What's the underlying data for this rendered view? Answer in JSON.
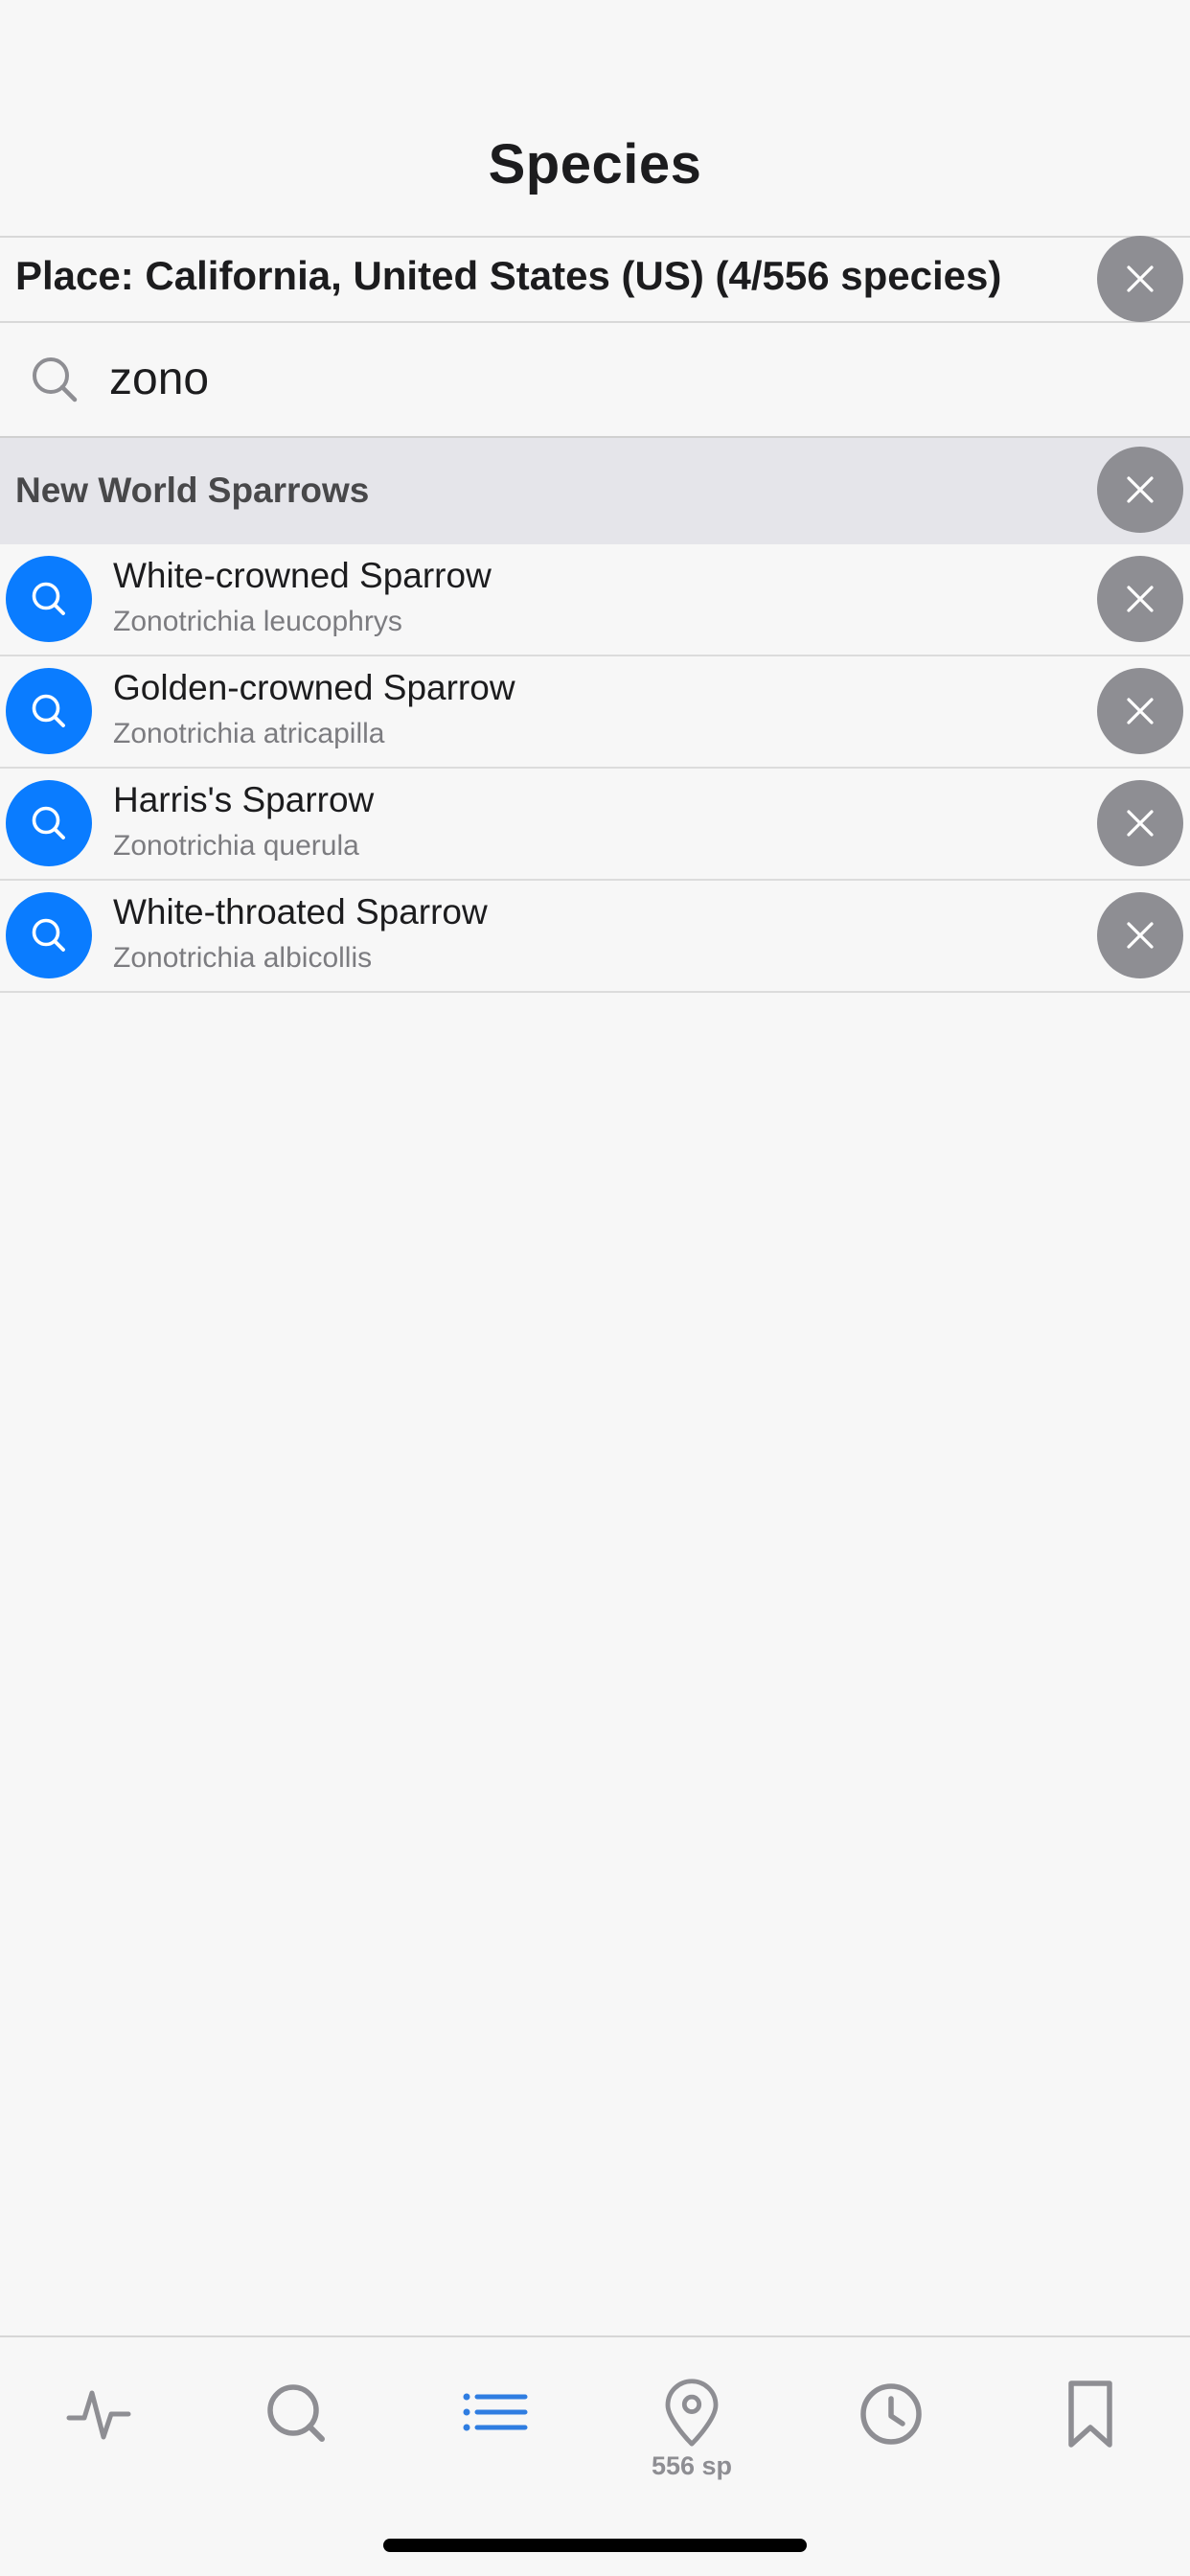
{
  "header": {
    "title": "Species"
  },
  "place_filter": {
    "label": "Place: California, United States (US) (4/556 species)",
    "clear_icon": "close-icon"
  },
  "search": {
    "value": "zono",
    "placeholder": "",
    "icon": "search-icon"
  },
  "group": {
    "label": "New World Sparrows",
    "clear_icon": "close-icon"
  },
  "species": [
    {
      "common": "White-crowned Sparrow",
      "scientific": "Zonotrichia leucophrys"
    },
    {
      "common": "Golden-crowned Sparrow",
      "scientific": "Zonotrichia atricapilla"
    },
    {
      "common": "Harris's Sparrow",
      "scientific": "Zonotrichia querula"
    },
    {
      "common": "White-throated Sparrow",
      "scientific": "Zonotrichia albicollis"
    }
  ],
  "tab_bar": {
    "tabs": [
      {
        "icon": "activity-icon",
        "active": false
      },
      {
        "icon": "search-icon",
        "active": false
      },
      {
        "icon": "list-icon",
        "active": true
      },
      {
        "icon": "map-pin-icon",
        "active": false,
        "badge": "556 sp"
      },
      {
        "icon": "clock-icon",
        "active": false
      },
      {
        "icon": "bookmark-icon",
        "active": false
      }
    ]
  },
  "colors": {
    "accent": "#0a7cff",
    "clear_button": "#8e8e93",
    "group_background": "#e5e5ea",
    "background": "#f7f7f7",
    "active_tab": "#2f7de1",
    "inactive_tab": "#8e8e93"
  }
}
